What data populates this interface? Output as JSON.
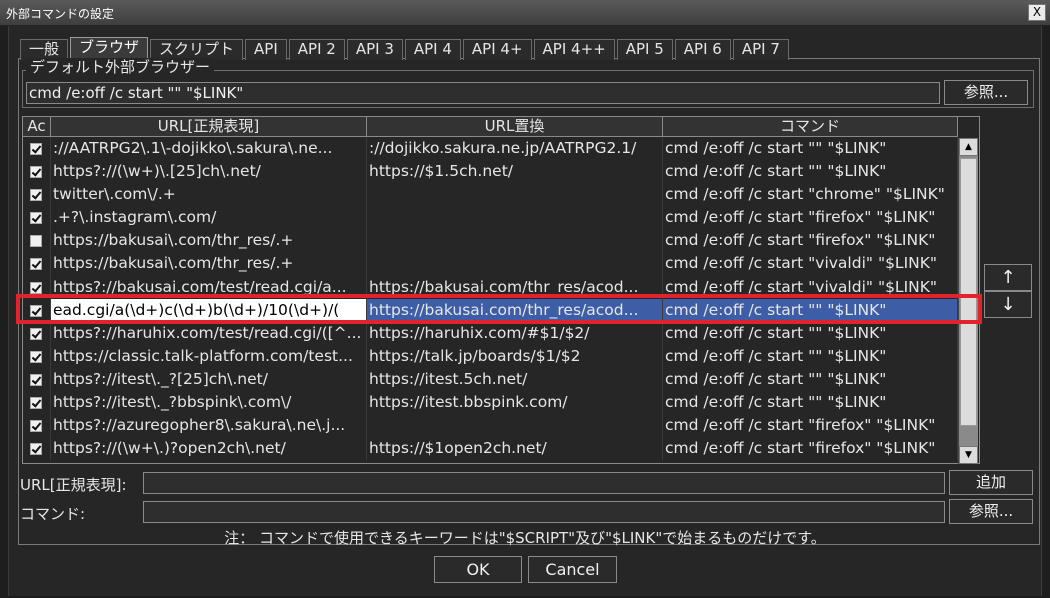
{
  "window": {
    "title": "外部コマンドの設定",
    "close_label": "X"
  },
  "tabs": [
    "一般",
    "ブラウザ",
    "スクリプト",
    "API",
    "API 2",
    "API 3",
    "API 4",
    "API 4+",
    "API 4++",
    "API 5",
    "API 6",
    "API 7"
  ],
  "browser": {
    "group_label": "デフォルト外部ブラウザー",
    "default_command": "cmd /e:off /c start \"\" \"$LINK\"",
    "browse_label": "参照..."
  },
  "table": {
    "headers": {
      "ac": "Ac",
      "url": "URL[正規表現]",
      "replace": "URL置換",
      "command": "コマンド"
    },
    "rows": [
      {
        "checked": true,
        "url": "://AATRPG2\\.1\\-dojikko\\.sakura\\.ne...",
        "replace": "://dojikko.sakura.ne.jp/AATRPG2.1/",
        "command": "cmd /e:off /c start \"\" \"$LINK\""
      },
      {
        "checked": true,
        "url": "https?://(\\w+)\\.[25]ch\\.net/",
        "replace": "https://$1.5ch.net/",
        "command": "cmd /e:off /c start \"\" \"$LINK\""
      },
      {
        "checked": true,
        "url": "twitter\\.com\\/.+",
        "replace": "",
        "command": "cmd /e:off /c start \"chrome\" \"$LINK\""
      },
      {
        "checked": true,
        "url": ".+?\\.instagram\\.com/",
        "replace": "",
        "command": "cmd /e:off /c start \"firefox\" \"$LINK\""
      },
      {
        "checked": false,
        "url": "https://bakusai\\.com/thr_res/.+",
        "replace": "",
        "command": "cmd /e:off /c start \"firefox\" \"$LINK\""
      },
      {
        "checked": true,
        "url": "https://bakusai\\.com/thr_res/.+",
        "replace": "",
        "command": "cmd /e:off /c start \"vivaldi\" \"$LINK\""
      },
      {
        "checked": true,
        "url": "https?://bakusai.com/test/read.cgi/a...",
        "replace": "https://bakusai.com/thr_res/acod...",
        "command": "cmd /e:off /c start \"vivaldi\" \"$LINK\""
      },
      {
        "checked": true,
        "url": "ead.cgi/a(\\d+)c(\\d+)b(\\d+)/10(\\d+)/(",
        "replace": "https://bakusai.com/thr_res/acod...",
        "command": "cmd /e:off /c start \"\" \"$LINK\"",
        "selected": true
      },
      {
        "checked": true,
        "url": "https?://haruhix.com/test/read.cgi/([^...",
        "replace": "https://haruhix.com/#$1/$2/",
        "command": "cmd /e:off /c start \"\" \"$LINK\""
      },
      {
        "checked": true,
        "url": "https://classic.talk-platform.com/test...",
        "replace": "https://talk.jp/boards/$1/$2",
        "command": "cmd /e:off /c start \"\" \"$LINK\""
      },
      {
        "checked": true,
        "url": "https?://itest\\._?[25]ch\\.net/",
        "replace": "https://itest.5ch.net/",
        "command": "cmd /e:off /c start \"\" \"$LINK\""
      },
      {
        "checked": true,
        "url": "https?://itest\\._?bbspink\\.com\\/",
        "replace": "https://itest.bbspink.com/",
        "command": "cmd /e:off /c start \"\" \"$LINK\""
      },
      {
        "checked": true,
        "url": "https?://azuregopher8\\.sakura\\.ne\\.j...",
        "replace": "",
        "command": "cmd /e:off /c start \"firefox\" \"$LINK\""
      },
      {
        "checked": true,
        "url": "https?://(\\w+\\.)?open2ch\\.net/",
        "replace": "https://$1open2ch.net/",
        "command": "cmd /e:off /c start \"firefox\" \"$LINK\""
      }
    ]
  },
  "move_up_label": "↑",
  "move_down_label": "↓",
  "form": {
    "url_label": "URL[正規表現]:",
    "url_value": "",
    "add_label": "追加",
    "command_label": "コマンド:",
    "command_value": "",
    "browse_label": "参照..."
  },
  "note": "注： コマンドで使用できるキーワードは\"$SCRIPT\"及び\"$LINK\"で始まるものだけです。",
  "ok_label": "OK",
  "cancel_label": "Cancel",
  "colors": {
    "selected_row": "#3d5ea7",
    "highlight_border": "#e1232b"
  }
}
